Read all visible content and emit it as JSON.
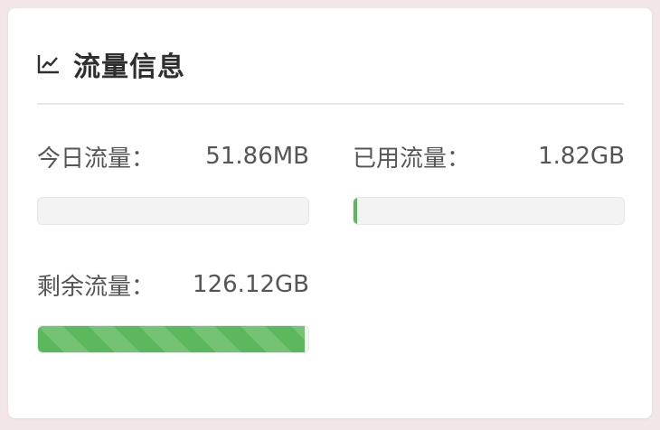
{
  "panel": {
    "title": "流量信息",
    "icon": "line-chart-icon"
  },
  "stats": {
    "today": {
      "label": "今日流量：",
      "value": "51.86MB",
      "fraction": 0.0
    },
    "used": {
      "label": "已用流量：",
      "value": "1.82GB",
      "fraction": 0.014
    },
    "remaining": {
      "label": "剩余流量：",
      "value": "126.12GB",
      "fraction": 0.986
    }
  },
  "colors": {
    "progress": "#5cb85c",
    "track": "#f3f3f3",
    "background": "#f2e6e9"
  }
}
